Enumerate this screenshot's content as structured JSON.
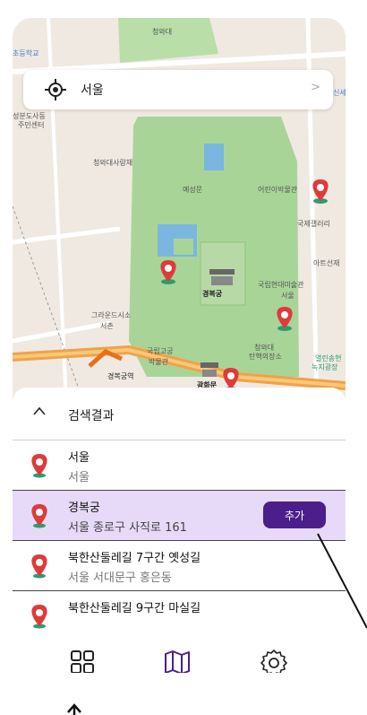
{
  "search": {
    "query": "서울",
    "arrow": ">"
  },
  "map": {
    "labels": [
      "청와대",
      "초등학교",
      "청와대사랑채",
      "예성문",
      "어린이박물관",
      "국제갤러리",
      "아트선재",
      "경복궁",
      "국립현대미술관 서울",
      "그라운드시소 서촌",
      "국립고궁 박물관",
      "청와대 탄핵의장소",
      "열린송현 녹지광장",
      "광화문",
      "경복궁역",
      "성분도사동 주민센터",
      "신세"
    ]
  },
  "results": {
    "header_chevron": "^",
    "title": "검색결과",
    "items": [
      {
        "name": "서울",
        "address": "서울",
        "selected": false
      },
      {
        "name": "경복궁",
        "address": "서울 종로구 사직로 161",
        "selected": true,
        "action": "추가"
      },
      {
        "name": "북한산둘레길 7구간 옛성길",
        "address": "서울 서대문구 홍은동",
        "selected": false
      },
      {
        "name": "북한산둘레길 9구간 마실길",
        "address": "",
        "selected": false
      }
    ]
  },
  "nav": {
    "items": [
      "grid-icon",
      "map-icon",
      "settings-icon"
    ],
    "active": "map-icon"
  },
  "colors": {
    "accent": "#4b1e8c",
    "selected_bg": "#e6daf8",
    "pin_red": "#e03a3a",
    "pin_base": "#2a9d6f",
    "park": "#a8d597"
  }
}
